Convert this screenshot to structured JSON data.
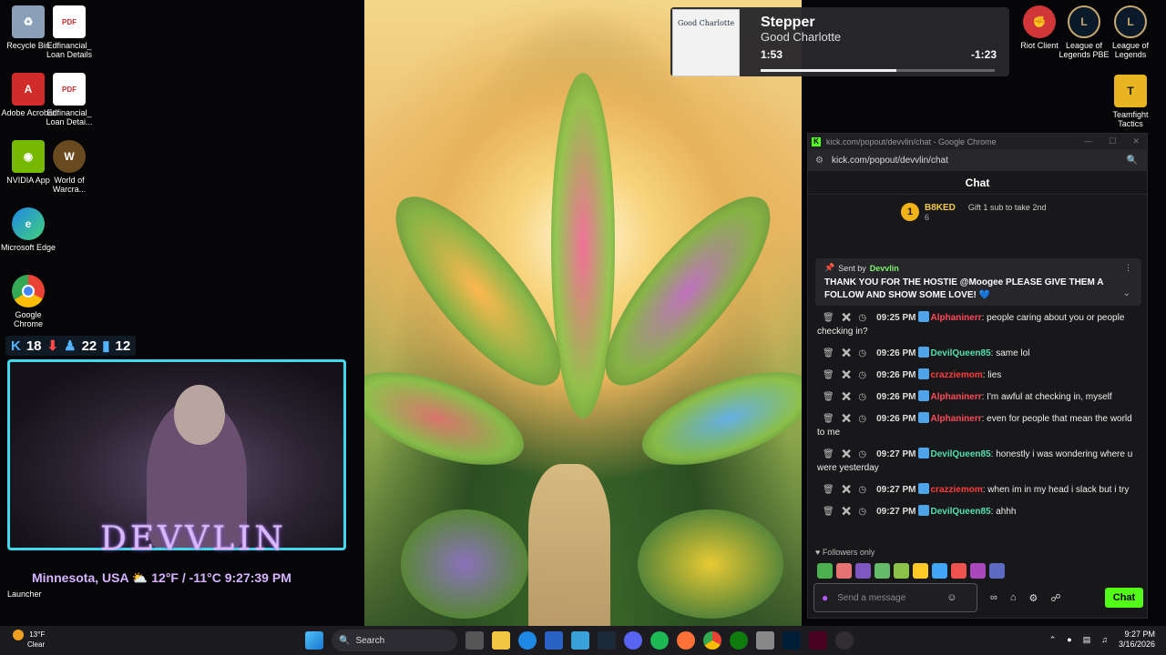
{
  "desktop_icons_left": [
    {
      "label": "Recycle Bin",
      "icon": "recycle-bin-icon",
      "color": "#8aa0b8"
    },
    {
      "label": "Edfinancial_ Loan Details",
      "icon": "pdf-icon",
      "color": "#d22b2b"
    },
    {
      "label": "Adobe Acrobat",
      "icon": "acrobat-icon",
      "color": "#d22b2b"
    },
    {
      "label": "Edfinancial_ Loan Detai...",
      "icon": "pdf-icon",
      "color": "#d22b2b"
    },
    {
      "label": "NVIDIA App",
      "icon": "nvidia-icon",
      "color": "#76b900"
    },
    {
      "label": "World of Warcra...",
      "icon": "wow-icon",
      "color": "#6a4a20"
    },
    {
      "label": "Microsoft Edge",
      "icon": "edge-icon",
      "color": "#1e88e5"
    },
    {
      "label": "Google Chrome",
      "icon": "chrome-icon",
      "color": "#4caf50"
    }
  ],
  "desktop_icons_right": [
    {
      "label": "Riot Client",
      "icon": "riot-icon",
      "color": "#d13639"
    },
    {
      "label": "League of Legends PBE",
      "icon": "lol-pbe-icon",
      "color": "#c8aa6e"
    },
    {
      "label": "League of Legends",
      "icon": "lol-icon",
      "color": "#c8aa6e"
    },
    {
      "label": "Teamfight Tactics",
      "icon": "tft-icon",
      "color": "#e8b422"
    }
  ],
  "stats": {
    "kills": "18",
    "a": "22",
    "b": "12"
  },
  "overlay": {
    "brand": "DEVVLIN",
    "weather": "Minnesota, USA ⛅ 12°F / -11°C 9:27:39 PM",
    "launcher_label": "Launcher"
  },
  "music": {
    "album_text": "Good Charlotte",
    "title": "Stepper",
    "artist": "Good Charlotte",
    "elapsed": "1:53",
    "remaining": "-1:23",
    "progress": 0.58
  },
  "chat_window": {
    "titlebar": "kick.com/popout/devvlin/chat - Google Chrome",
    "url": "kick.com/popout/devvlin/chat",
    "header": "Chat",
    "gift": {
      "coin": "1",
      "user": "B8KED",
      "count": "6",
      "message": "Gift 1 sub to take 2nd"
    },
    "pinned": {
      "sent_by": "Sent by",
      "user": "Devvlin",
      "text": "THANK YOU FOR THE HOSTIE @Moogee PLEASE GIVE THEM A FOLLOW AND SHOW SOME LOVE! 💙"
    },
    "messages": [
      {
        "time": "09:25 PM",
        "user": "Alphaninerr",
        "color": "#ff4a5a",
        "text": ": people caring about you or people checking in?"
      },
      {
        "time": "09:26 PM",
        "user": "DevilQueen85",
        "color": "#53e0b0",
        "text": ": same lol"
      },
      {
        "time": "09:26 PM",
        "user": "crazziemom",
        "color": "#ff3b3b",
        "text": ": lies"
      },
      {
        "time": "09:26 PM",
        "user": "Alphaninerr",
        "color": "#ff4a5a",
        "text": ": I'm awful at checking in, myself"
      },
      {
        "time": "09:26 PM",
        "user": "Alphaninerr",
        "color": "#ff4a5a",
        "text": ": even for people that mean the world to me"
      },
      {
        "time": "09:27 PM",
        "user": "DevilQueen85",
        "color": "#53e0b0",
        "text": ": honestly i was wondering where u were yesterday"
      },
      {
        "time": "09:27 PM",
        "user": "crazziemom",
        "color": "#ff3b3b",
        "text": ": when im in my head i slack but i try"
      },
      {
        "time": "09:27 PM",
        "user": "DevilQueen85",
        "color": "#53e0b0",
        "text": ": ahhh"
      }
    ],
    "followers_only": "Followers only",
    "input_placeholder": "Send a message",
    "send_label": "Chat"
  },
  "taskbar": {
    "weather_temp": "13°F",
    "weather_desc": "Clear",
    "search_label": "Search",
    "time": "9:27 PM",
    "date": "3/16/2026"
  }
}
